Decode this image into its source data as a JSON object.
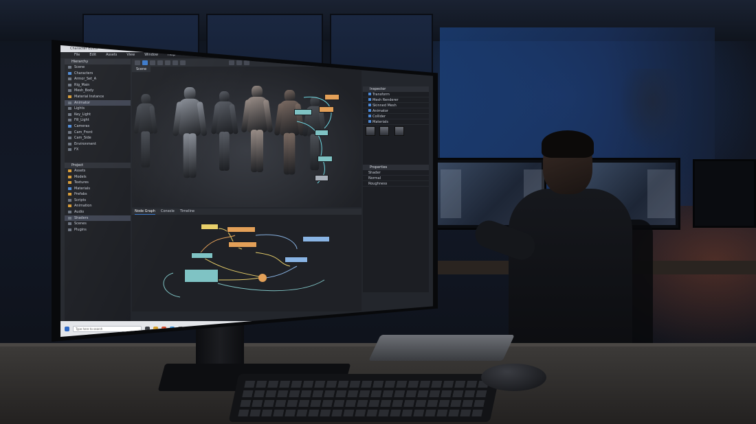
{
  "window": {
    "title": "Character Editor"
  },
  "menu": [
    "File",
    "Edit",
    "Assets",
    "View",
    "Window",
    "Help"
  ],
  "hierarchy": {
    "header": "Hierarchy",
    "items": [
      {
        "label": "Scene",
        "type": "plain"
      },
      {
        "label": "Characters",
        "type": "blue"
      },
      {
        "label": "Armor_Set_A",
        "type": "plain"
      },
      {
        "label": "Rig_Main",
        "type": "plain"
      },
      {
        "label": "Mesh_Body",
        "type": "plain"
      },
      {
        "label": "Material Instance",
        "type": "orange"
      },
      {
        "label": "Animator",
        "type": "plain",
        "selected": true
      },
      {
        "label": "Lights",
        "type": "plain"
      },
      {
        "label": "Key_Light",
        "type": "plain"
      },
      {
        "label": "Fill_Light",
        "type": "plain"
      },
      {
        "label": "Cameras",
        "type": "blue"
      },
      {
        "label": "Cam_Front",
        "type": "plain"
      },
      {
        "label": "Cam_Side",
        "type": "plain"
      },
      {
        "label": "Environment",
        "type": "plain"
      },
      {
        "label": "FX",
        "type": "plain"
      }
    ]
  },
  "project": {
    "header": "Project",
    "items": [
      {
        "label": "Assets",
        "type": "orange"
      },
      {
        "label": "Models",
        "type": "orange"
      },
      {
        "label": "Textures",
        "type": "orange"
      },
      {
        "label": "Materials",
        "type": "blue"
      },
      {
        "label": "Prefabs",
        "type": "orange"
      },
      {
        "label": "Scripts",
        "type": "plain"
      },
      {
        "label": "Animation",
        "type": "orange"
      },
      {
        "label": "Audio",
        "type": "plain"
      },
      {
        "label": "Shaders",
        "type": "plain",
        "selected": true
      },
      {
        "label": "Scenes",
        "type": "plain"
      },
      {
        "label": "Plugins",
        "type": "plain"
      }
    ]
  },
  "viewport": {
    "tab": "Scene"
  },
  "inspector": {
    "header": "Inspector",
    "rows": [
      "Transform",
      "Mesh Renderer",
      "Skinned Mesh",
      "Animator",
      "Collider",
      "Materials"
    ],
    "lower_header": "Properties",
    "lower_rows": [
      "Shader",
      "Normal",
      "Roughness"
    ]
  },
  "bottom": {
    "tabs": [
      "Node Graph",
      "Console",
      "Timeline"
    ]
  },
  "taskbar": {
    "search_placeholder": "Type here to search"
  },
  "colors": {
    "accent": "#3a78c8",
    "node_teal": "#7fc3c4",
    "node_orange": "#e3a058"
  }
}
